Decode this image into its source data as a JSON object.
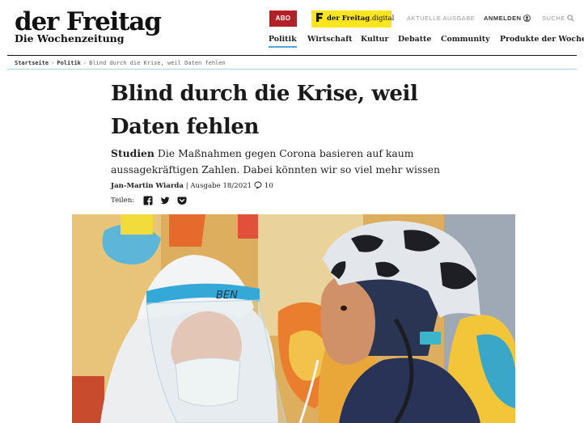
{
  "brand": {
    "title": "der Freitag",
    "subtitle": "Die Wochenzeitung"
  },
  "topbar": {
    "abo_label": "ABO",
    "digital_prefix": "der Freitag",
    "digital_suffix": ".digital",
    "aktuelle_ausgabe": "AKTUELLE AUSGABE",
    "anmelden": "ANMELDEN",
    "suche": "SUCHE"
  },
  "nav": {
    "items": [
      "Politik",
      "Wirtschaft",
      "Kultur",
      "Debatte",
      "Community",
      "Produkte der Woche"
    ],
    "active": "Politik"
  },
  "breadcrumb": {
    "items": [
      "Startseite",
      "Politik",
      "Blind durch die Krise, weil Daten fehlen"
    ],
    "separator": "›"
  },
  "article": {
    "headline": "Blind durch die Krise, weil Daten fehlen",
    "kicker": "Studien",
    "teaser": "Die Maßnahmen gegen Corona basieren auf kaum aussagekräftigen Zahlen. Dabei könnten wir so viel mehr wissen",
    "author": "Jan-Martin Wiarda",
    "issue": "Ausgabe 18/2021",
    "comments": "10",
    "share_label": "Teilen:",
    "share_icons": [
      "facebook-icon",
      "twitter-icon",
      "pocket-icon"
    ],
    "image_face_shield_text": "BEN"
  },
  "colors": {
    "abo_bg": "#b22028",
    "digital_bg": "#ffe61c",
    "nav_active_underline": "#4fa8d6",
    "separator_blue": "#a9d3ea"
  }
}
